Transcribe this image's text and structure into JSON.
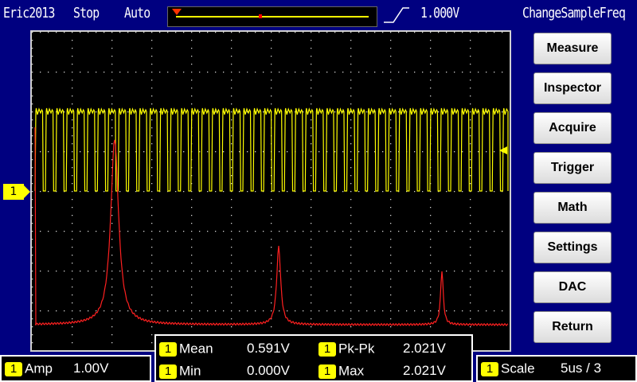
{
  "status": {
    "title": "Eric2013",
    "run_state": "Stop",
    "trigger_mode": "Auto",
    "trigger_level": "1.000V",
    "action": "ChangeSampleFreq"
  },
  "channel": {
    "marker": "1"
  },
  "menu": [
    {
      "id": "measure",
      "label": "Measure"
    },
    {
      "id": "inspector",
      "label": "Inspector"
    },
    {
      "id": "acquire",
      "label": "Acquire"
    },
    {
      "id": "trigger",
      "label": "Trigger"
    },
    {
      "id": "math",
      "label": "Math"
    },
    {
      "id": "settings",
      "label": "Settings"
    },
    {
      "id": "dac",
      "label": "DAC"
    },
    {
      "id": "return",
      "label": "Return"
    }
  ],
  "amp": {
    "channel": "1",
    "label": "Amp",
    "value": "1.00V"
  },
  "measurements": {
    "mean": {
      "channel": "1",
      "label": "Mean",
      "value": "0.591V"
    },
    "pkpk": {
      "channel": "1",
      "label": "Pk-Pk",
      "value": "2.021V"
    },
    "min": {
      "channel": "1",
      "label": "Min",
      "value": "0.000V"
    },
    "max": {
      "channel": "1",
      "label": "Max",
      "value": "2.021V"
    }
  },
  "scale": {
    "channel": "1",
    "label": "Scale",
    "value": "5us / 3"
  },
  "colors": {
    "background": "#000080",
    "grid": "#ffffff",
    "channel1": "#ffff00",
    "fft": "#ff2020"
  }
}
